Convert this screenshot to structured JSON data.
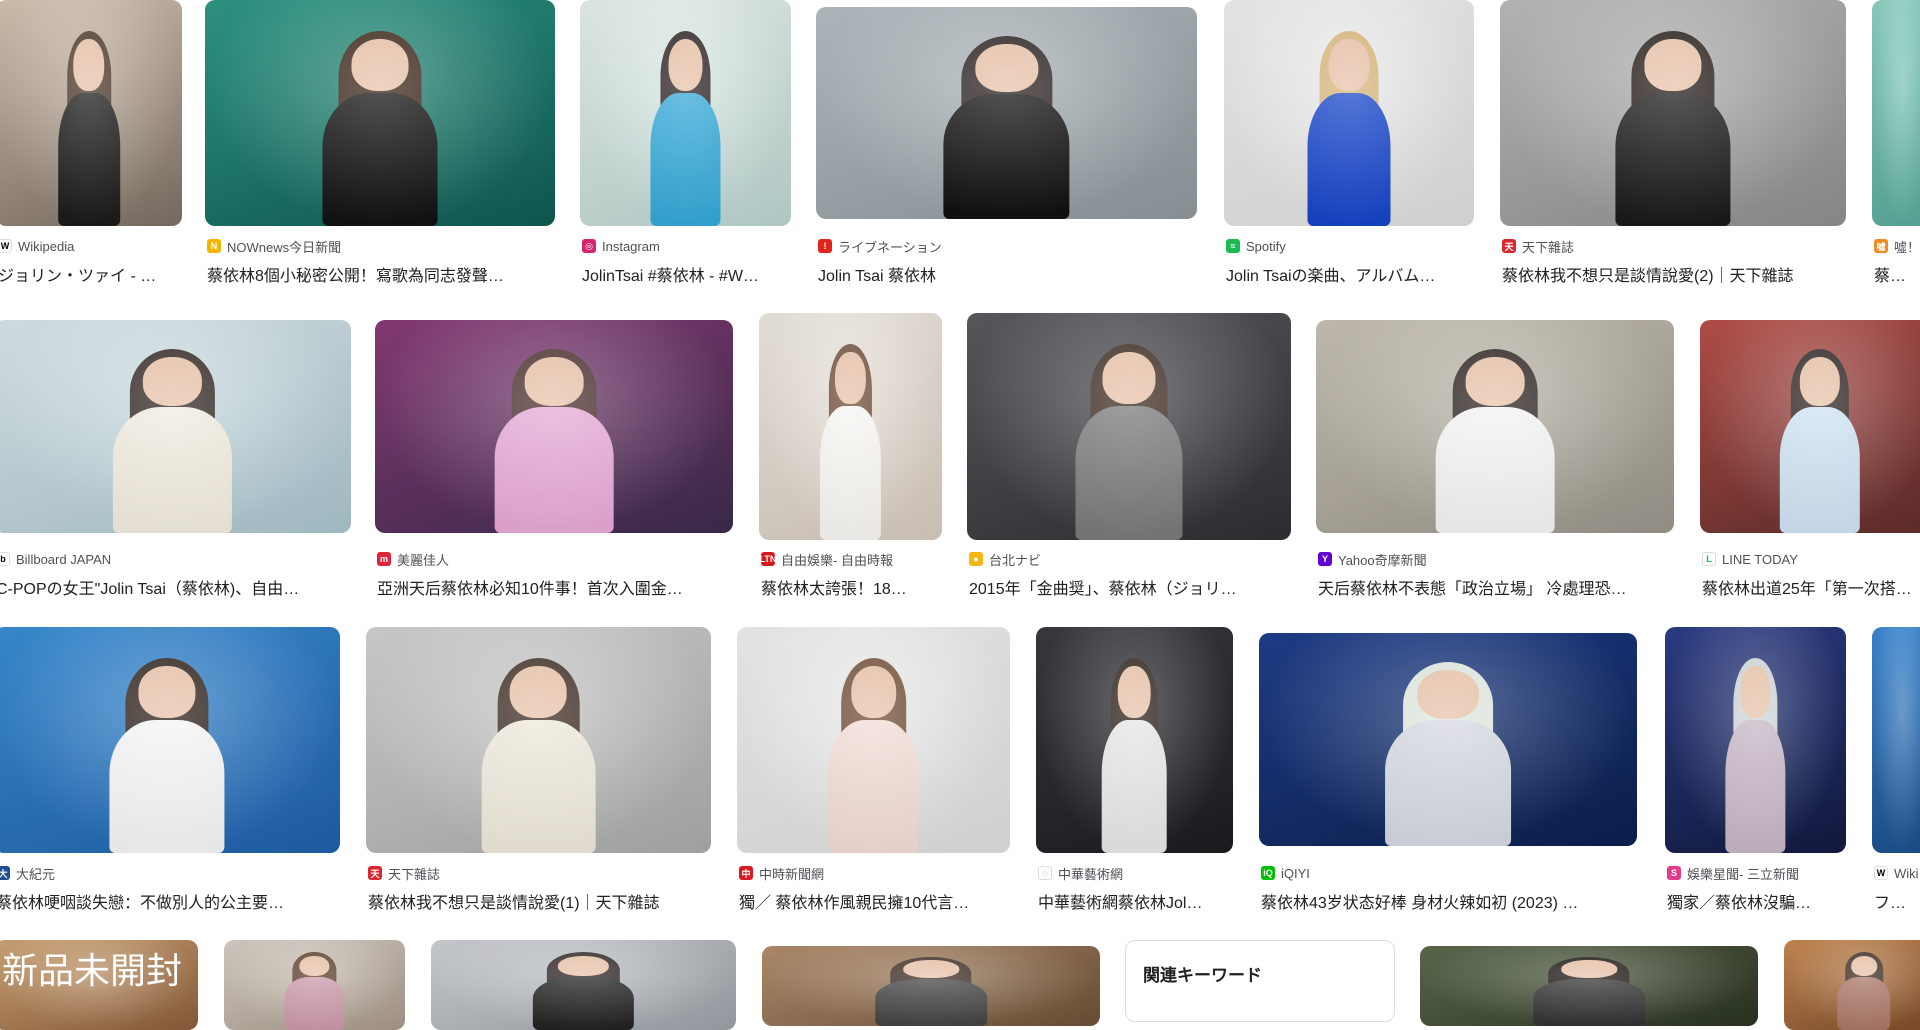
{
  "rows": [
    [
      {
        "source": "Wikipedia",
        "title": "ジョリン・ツァイ - …",
        "fav": "W",
        "fav_color": "#ffffff",
        "fav_text": "#000000",
        "bg1": "#d9c6b4",
        "bg2": "#7b6f64",
        "hair": "#4a3528",
        "outfit": "#1b1b1b"
      },
      {
        "source": "NOWnews今日新聞",
        "title": "蔡依林8個小秘密公開！寫歌為同志發聲…",
        "fav": "N",
        "fav_color": "#f5b400",
        "fav_text": "#ffffff",
        "bg1": "#2f9a86",
        "bg2": "#0f5a52",
        "hair": "#3a2418",
        "outfit": "#121212"
      },
      {
        "source": "Instagram",
        "title": "JolinTsai #蔡依林 - #W…",
        "fav": "◎",
        "fav_color": "#d6246e",
        "fav_text": "#ffffff",
        "bg1": "#e9f2ee",
        "bg2": "#b9d3ce",
        "hair": "#2b2020",
        "outfit": "#35a9d8"
      },
      {
        "source": "ライブネーション",
        "title": "Jolin Tsai 蔡依林",
        "fav": "!",
        "fav_color": "#e1251b",
        "fav_text": "#ffffff",
        "bg1": "#b7bfc4",
        "bg2": "#8e979c",
        "hair": "#2a2020",
        "outfit": "#111111"
      },
      {
        "source": "Spotify",
        "title": "Jolin Tsaiの楽曲、アルバム…",
        "fav": "≈",
        "fav_color": "#1db954",
        "fav_text": "#ffffff",
        "bg1": "#f1f1f1",
        "bg2": "#dcdcdc",
        "hair": "#d8b47a",
        "outfit": "#1745c9"
      },
      {
        "source": "天下雜誌",
        "title": "蔡依林我不想只是談情說愛(2)｜天下雜誌",
        "fav": "天",
        "fav_color": "#d7282f",
        "fav_text": "#ffffff",
        "bg1": "#bdbdbd",
        "bg2": "#8d8d8d",
        "hair": "#231a16",
        "outfit": "#1a1a1a"
      },
      {
        "source": "噓！",
        "title": "蔡依林",
        "fav": "噓",
        "fav_color": "#f08a24",
        "fav_text": "#ffffff",
        "bg1": "#8fd3c4",
        "bg2": "#58a99a",
        "hair": "#2b2020",
        "outfit": "#44a"
      }
    ],
    [
      {
        "source": "Billboard JAPAN",
        "title": "C-POPの女王\"Jolin Tsai（蔡依林)、自由…",
        "fav": "b",
        "fav_color": "#ffffff",
        "fav_text": "#000000",
        "bg1": "#dce8ec",
        "bg2": "#a9c3cc",
        "hair": "#2f2420",
        "outfit": "#f2ece0"
      },
      {
        "source": "美麗佳人",
        "title": "亞洲天后蔡依林必知10件事！首次入圍金…",
        "fav": "m",
        "fav_color": "#e0243a",
        "fav_text": "#ffffff",
        "bg1": "#8a3c78",
        "bg2": "#3b2b4c",
        "hair": "#4a2d2d",
        "outfit": "#e7a9d8"
      },
      {
        "source": "自由娛樂- 自由時報",
        "title": "蔡依林太誇張！18…",
        "fav": "LTN",
        "fav_color": "#d71920",
        "fav_text": "#ffffff",
        "bg1": "#f0eae4",
        "bg2": "#d5c9bd",
        "hair": "#6b4a36",
        "outfit": "#f8f6f2"
      },
      {
        "source": "台北ナビ",
        "title": "2015年「金曲奨」、蔡依林（ジョリ…",
        "fav": "●",
        "fav_color": "#f3b614",
        "fav_text": "#ffffff",
        "bg1": "#5b5b60",
        "bg2": "#2e2e33",
        "hair": "#3b2a20",
        "outfit": "#7a7a7a"
      },
      {
        "source": "Yahoo奇摩新聞",
        "title": "天后蔡依林不表態「政治立場」 冷處理恐…",
        "fav": "Y",
        "fav_color": "#6001d2",
        "fav_text": "#ffffff",
        "bg1": "#c9c3b6",
        "bg2": "#9a958b",
        "hair": "#2b2220",
        "outfit": "#f4f4f4"
      },
      {
        "source": "LINE TODAY",
        "title": "蔡依林出道25年「第一次搭…",
        "fav": "L",
        "fav_color": "#ffffff",
        "fav_text": "#06c755",
        "bg1": "#b9504a",
        "bg2": "#5e2d2b",
        "hair": "#2b2220",
        "outfit": "#cfe3f3"
      }
    ],
    [
      {
        "source": "大紀元",
        "title": "蔡依林哽咽談失戀：不做別人的公主要…",
        "fav": "大",
        "fav_color": "#1d4f91",
        "fav_text": "#ffffff",
        "bg1": "#3a8fd6",
        "bg2": "#1f5fa8",
        "hair": "#2a1e18",
        "outfit": "#f5f5f5"
      },
      {
        "source": "天下雜誌",
        "title": "蔡依林我不想只是談情說愛(1)｜天下雜誌",
        "fav": "天",
        "fav_color": "#d7282f",
        "fav_text": "#ffffff",
        "bg1": "#d3d3d3",
        "bg2": "#a9a9a9",
        "hair": "#3b2a20",
        "outfit": "#efe9dc"
      },
      {
        "source": "中時新聞網",
        "title": "獨／ 蔡依林作風親民擁10代言…",
        "fav": "中",
        "fav_color": "#d71920",
        "fav_text": "#ffffff",
        "bg1": "#f1f1f1",
        "bg2": "#dcdcdc",
        "hair": "#6e4a34",
        "outfit": "#f3dcd6"
      },
      {
        "source": "中華藝術網",
        "title": "中華藝術網蔡依林Jol…",
        "fav": "◌",
        "fav_color": "#ffffff",
        "fav_text": "#6a6a9a",
        "bg1": "#3a3a40",
        "bg2": "#1c1c20",
        "hair": "#2b1f18",
        "outfit": "#e7e7e7"
      },
      {
        "source": "iQIYI",
        "title": "蔡依林43岁状态好棒 身材火辣如初 (2023) …",
        "fav": "iQ",
        "fav_color": "#00be06",
        "fav_text": "#ffffff",
        "bg1": "#1f3f8c",
        "bg2": "#0c1f4d",
        "hair": "#dfe6df",
        "outfit": "#d6d9e2"
      },
      {
        "source": "娛樂星聞- 三立新聞",
        "title": "獨家／蔡依林沒騙…",
        "fav": "S",
        "fav_color": "#e23b8a",
        "fav_text": "#ffffff",
        "bg1": "#2d3e88",
        "bg2": "#121a40",
        "hair": "#cfd4d8",
        "outfit": "#c7b7c6"
      },
      {
        "source": "Wiki",
        "title": "ファイ…",
        "fav": "W",
        "fav_color": "#ffffff",
        "fav_text": "#000000",
        "bg1": "#3d8ad6",
        "bg2": "#1b4e8a",
        "hair": "#2a1e18",
        "outfit": "#2a2a2a"
      }
    ],
    [
      {
        "source": "",
        "title": "",
        "thumb_text": "新品未開封",
        "bg1": "#d2a878",
        "bg2": "#8a5c3a",
        "hair": "#3b2a20",
        "outfit": "#cda"
      },
      {
        "source": "",
        "title": "",
        "bg1": "#d9d1c8",
        "bg2": "#a69889",
        "hair": "#5a3d2a",
        "outfit": "#c9a"
      },
      {
        "source": "",
        "title": "",
        "bg1": "#cfd2d6",
        "bg2": "#9aa0a6",
        "hair": "#2b2020",
        "outfit": "#222"
      },
      {
        "source": "",
        "title": "",
        "bg1": "#b48f6e",
        "bg2": "#6b5036",
        "hair": "#3b2a20",
        "outfit": "#444"
      },
      {
        "source": "",
        "title": "",
        "bg1": "#5d6b4e",
        "bg2": "#2a3322",
        "hair": "#1a1410",
        "outfit": "#333"
      },
      {
        "source": "",
        "title": "",
        "bg1": "#c98a52",
        "bg2": "#7a4a28",
        "hair": "#3b2a20",
        "outfit": "#a76"
      }
    ]
  ],
  "related": {
    "title": "関連キーワード"
  }
}
